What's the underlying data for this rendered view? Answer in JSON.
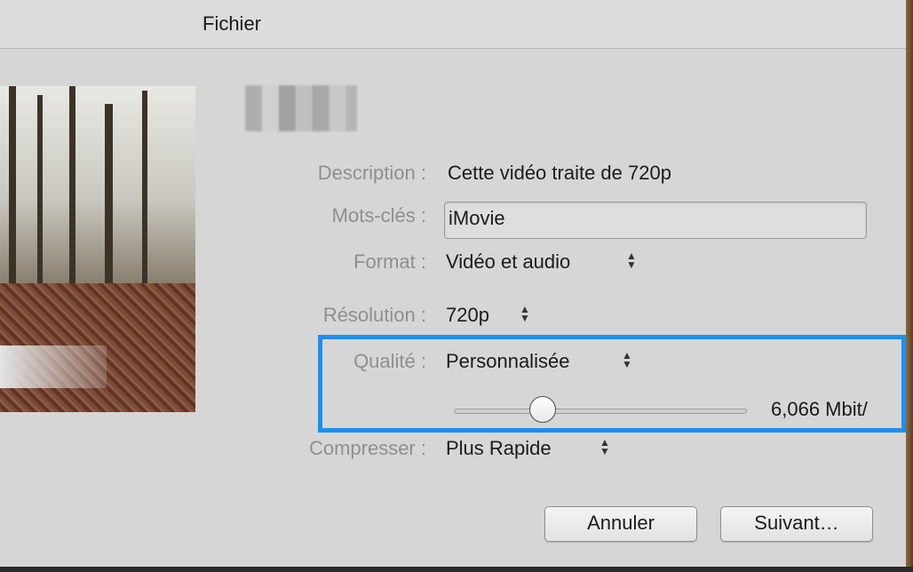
{
  "dialog": {
    "title": "Fichier"
  },
  "form": {
    "description": {
      "label": "Description :",
      "value": "Cette vidéo traite de 720p"
    },
    "keywords": {
      "label": "Mots-clés :",
      "value": "iMovie"
    },
    "format": {
      "label": "Format :",
      "value": "Vidéo et audio"
    },
    "resolution": {
      "label": "Résolution :",
      "value": "720p"
    },
    "quality": {
      "label": "Qualité :",
      "value": "Personnalisée",
      "bitrate": "6,066 Mbit/"
    },
    "compress": {
      "label": "Compresser :",
      "value": "Plus Rapide"
    }
  },
  "buttons": {
    "cancel": "Annuler",
    "next": "Suivant…"
  },
  "colors": {
    "highlight": "#1c8ff0"
  },
  "icons": {
    "stepper": "up-down-arrows-icon",
    "slider": "slider-knob"
  }
}
